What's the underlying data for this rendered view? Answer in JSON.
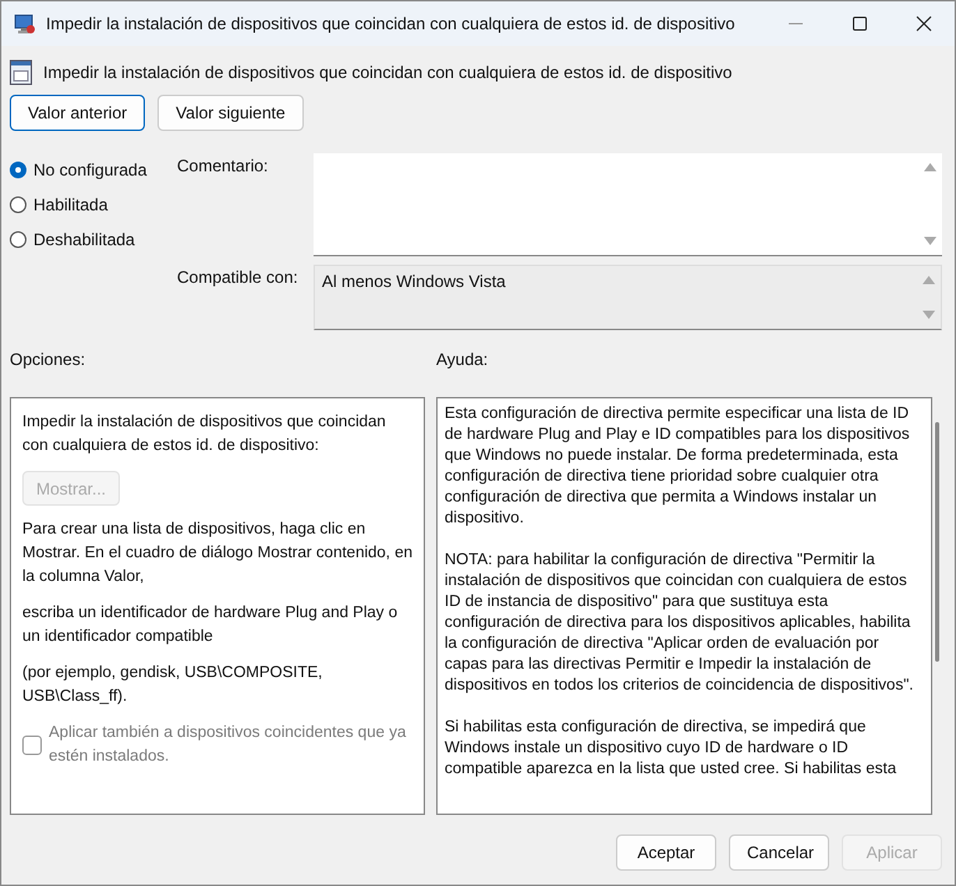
{
  "window": {
    "title": "Impedir la instalación de dispositivos que coincidan con cualquiera de estos id. de dispositivo"
  },
  "policy": {
    "name": "Impedir la instalación de dispositivos que coincidan con cualquiera de estos id. de dispositivo"
  },
  "nav_buttons": [
    {
      "label": "Valor anterior",
      "focused": true
    },
    {
      "label": "Valor siguiente",
      "focused": false
    }
  ],
  "state_options": [
    {
      "label": "No configurada",
      "selected": true
    },
    {
      "label": "Habilitada",
      "selected": false
    },
    {
      "label": "Deshabilitada",
      "selected": false
    }
  ],
  "comment": {
    "label": "Comentario:"
  },
  "compatible": {
    "label": "Compatible con:",
    "value": "Al menos Windows Vista"
  },
  "options": {
    "heading": "Opciones:",
    "items": [
      {
        "kind": "text",
        "text": "Impedir la instalación de dispositivos que coincidan con cualquiera de estos id. de dispositivo:"
      },
      {
        "kind": "button",
        "label": "Mostrar...",
        "disabled": true
      },
      {
        "kind": "text",
        "text": "Para crear una lista de dispositivos, haga clic en Mostrar. En el cuadro de diálogo Mostrar contenido, en la columna Valor,"
      },
      {
        "kind": "text",
        "text": "escriba un identificador de hardware Plug and Play o un identificador compatible"
      },
      {
        "kind": "text",
        "text": "(por ejemplo, gendisk, USB\\COMPOSITE, USB\\Class_ff)."
      },
      {
        "kind": "checkbox",
        "label": "Aplicar también a dispositivos coincidentes que ya estén instalados.",
        "checked": false,
        "disabled": true
      }
    ]
  },
  "help": {
    "heading": "Ayuda:",
    "paragraphs": [
      "Esta configuración de directiva permite especificar una lista de ID de hardware Plug and Play e ID compatibles para los dispositivos que Windows no puede instalar. De forma predeterminada, esta configuración de directiva tiene prioridad sobre cualquier otra configuración de directiva que permita a Windows instalar un dispositivo.",
      "NOTA: para habilitar la configuración de directiva \"Permitir la instalación de dispositivos que coincidan con cualquiera de estos ID de instancia de dispositivo\" para que sustituya esta configuración de directiva para los dispositivos aplicables, habilita la configuración de directiva \"Aplicar orden de evaluación por capas para las directivas Permitir e Impedir la instalación de dispositivos en todos los criterios de coincidencia de dispositivos\".",
      "Si habilitas esta configuración de directiva, se impedirá que Windows instale un dispositivo cuyo ID de hardware o ID compatible aparezca en la lista que usted cree. Si habilitas esta"
    ]
  },
  "footer_buttons": [
    {
      "label": "Aceptar",
      "disabled": false
    },
    {
      "label": "Cancelar",
      "disabled": false
    },
    {
      "label": "Aplicar",
      "disabled": true
    }
  ]
}
